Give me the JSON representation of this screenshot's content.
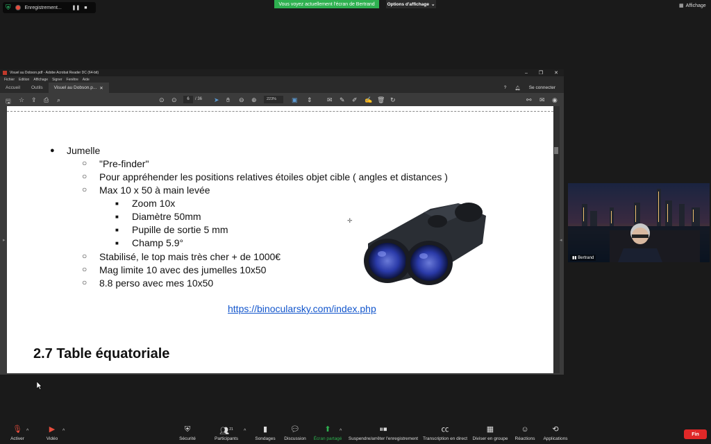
{
  "zoom": {
    "recording_label": "Enregistrement...",
    "share_banner": "Vous voyez actuellement l'écran de Bertrand",
    "view_options": "Options d'affichage",
    "view_options_caret": "⌄",
    "affichage": "Affichage",
    "participant_name": "Bertrand",
    "participant_count": "21",
    "bottom_buttons": {
      "activer": "Activer",
      "video": "Vidéo",
      "securite": "Sécurité",
      "participants": "Participants",
      "sondages": "Sondages",
      "discussion": "Discussion",
      "ecran_partage": "Écran partagé",
      "suspendre": "Suspendre/arrêter l'enregistrement",
      "transcription": "Transcription en direct",
      "diviser": "Diviser en groupe",
      "reactions": "Réactions",
      "applications": "Applications",
      "fin": "Fin"
    },
    "colors": {
      "share_green": "#2eb150",
      "end_red": "#e02828"
    }
  },
  "acrobat": {
    "title": "Visuel au Dobson.pdf - Adobe Acrobat Reader DC (64-bit)",
    "menu": [
      "Fichier",
      "Edition",
      "Affichage",
      "Signer",
      "Fenêtre",
      "Aide"
    ],
    "tabs": [
      "Accueil",
      "Outils",
      "Visuel au Dobson.p..."
    ],
    "sign_in": "Se connecter",
    "page_current": "6",
    "page_total": "/ 36",
    "zoom": "223%"
  },
  "slide": {
    "bullet_main": "Jumelle",
    "items": [
      "\"Pre-finder\"",
      "Pour appréhender les positions relatives étoiles objet cible ( angles et distances )",
      "Max 10 x 50 à main levée"
    ],
    "subitems": [
      "Zoom 10x",
      "Diamètre 50mm",
      "Pupille de sortie 5 mm",
      "Champ 5.9°"
    ],
    "items_after": [
      "Stabilisé, le top mais très cher + de 1000€",
      "Mag limite 10 avec des jumelles 10x50",
      "8.8 perso avec mes 10x50"
    ],
    "link": "https://binocularsky.com/index.php",
    "section_title": "2.7 Table équatoriale"
  }
}
